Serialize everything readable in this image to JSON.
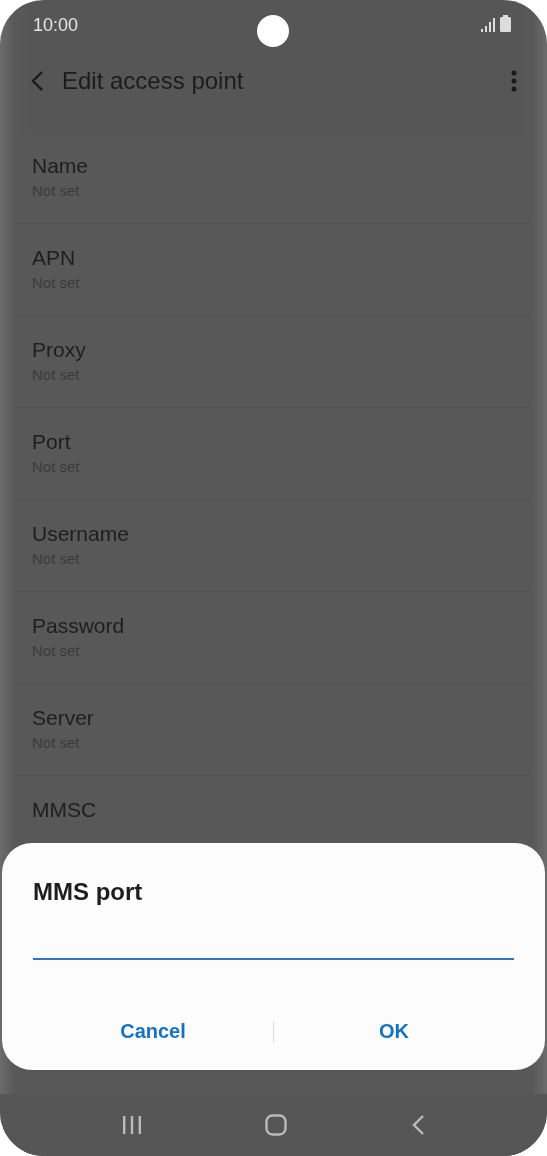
{
  "status_bar": {
    "time": "10:00"
  },
  "header": {
    "title": "Edit access point"
  },
  "settings": [
    {
      "label": "Name",
      "value": "Not set"
    },
    {
      "label": "APN",
      "value": "Not set"
    },
    {
      "label": "Proxy",
      "value": "Not set"
    },
    {
      "label": "Port",
      "value": "Not set"
    },
    {
      "label": "Username",
      "value": "Not set"
    },
    {
      "label": "Password",
      "value": "Not set"
    },
    {
      "label": "Server",
      "value": "Not set"
    },
    {
      "label": "MMSC"
    }
  ],
  "dialog": {
    "title": "MMS port",
    "buttons": [
      "Cancel",
      "OK"
    ]
  }
}
